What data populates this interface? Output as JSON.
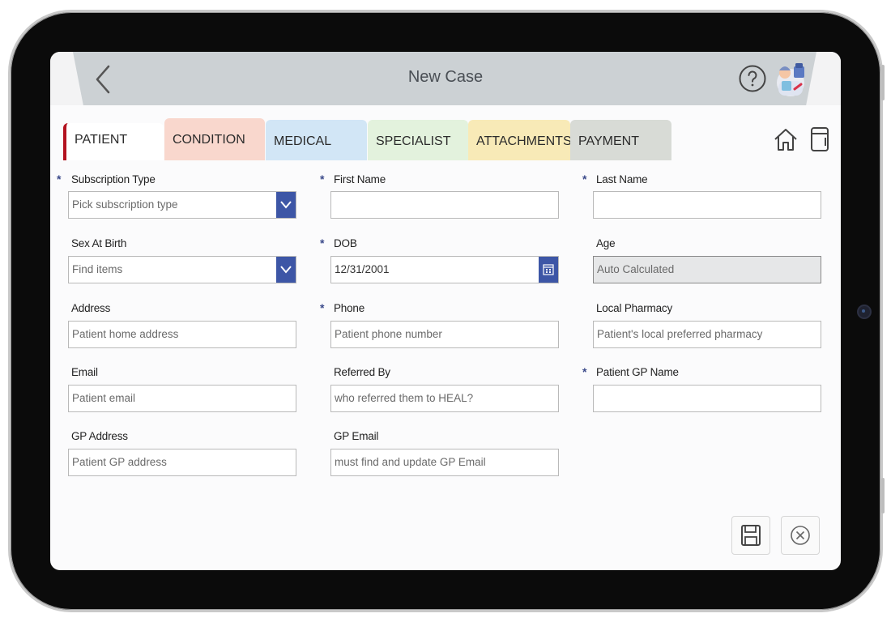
{
  "header": {
    "title": "New Case",
    "back_icon": "chevron-left-icon",
    "help_icon": "question-circle-icon",
    "avatar_icon": "doctor-avatar-icon"
  },
  "tabs": [
    {
      "label": "PATIENT",
      "color": "#ffffff",
      "active": true
    },
    {
      "label": "CONDITION",
      "color": "#f9d7cd"
    },
    {
      "label": "MEDICAL",
      "color": "#d2e6f6"
    },
    {
      "label": "SPECIALIST",
      "color": "#e3f2dd"
    },
    {
      "label": "ATTACHMENTS",
      "color": "#f8eab7"
    },
    {
      "label": "PAYMENT",
      "color": "#d8dbd6"
    }
  ],
  "tab_icons": [
    "home-icon",
    "document-icon"
  ],
  "form": {
    "subscription_type": {
      "label": "Subscription Type",
      "placeholder": "Pick subscription type",
      "required": "*"
    },
    "first_name": {
      "label": "First Name",
      "value": "",
      "required": "*"
    },
    "last_name": {
      "label": "Last Name",
      "value": "",
      "required": "*"
    },
    "sex_at_birth": {
      "label": "Sex At Birth",
      "placeholder": "Find items"
    },
    "dob": {
      "label": "DOB",
      "value": "12/31/2001",
      "required": "*"
    },
    "age": {
      "label": "Age",
      "placeholder": "Auto Calculated"
    },
    "address": {
      "label": "Address",
      "placeholder": "Patient home address"
    },
    "phone": {
      "label": "Phone",
      "placeholder": "Patient phone number",
      "required": "*"
    },
    "local_pharmacy": {
      "label": "Local Pharmacy",
      "placeholder": "Patient's local preferred pharmacy"
    },
    "email": {
      "label": "Email",
      "placeholder": "Patient email"
    },
    "referred_by": {
      "label": "Referred By",
      "placeholder": "who referred them to HEAL?"
    },
    "gp_name": {
      "label": "Patient GP Name",
      "value": "",
      "required": "*"
    },
    "gp_address": {
      "label": "GP Address",
      "placeholder": "Patient GP address"
    },
    "gp_email": {
      "label": "GP Email",
      "placeholder": "must find and update GP Email"
    }
  },
  "actions": {
    "save_icon": "save-icon",
    "cancel_icon": "close-circle-icon"
  },
  "colors": {
    "accent": "#3d56a6",
    "active_tab_marker": "#b3121f",
    "header_bg": "#ccd1d4"
  }
}
